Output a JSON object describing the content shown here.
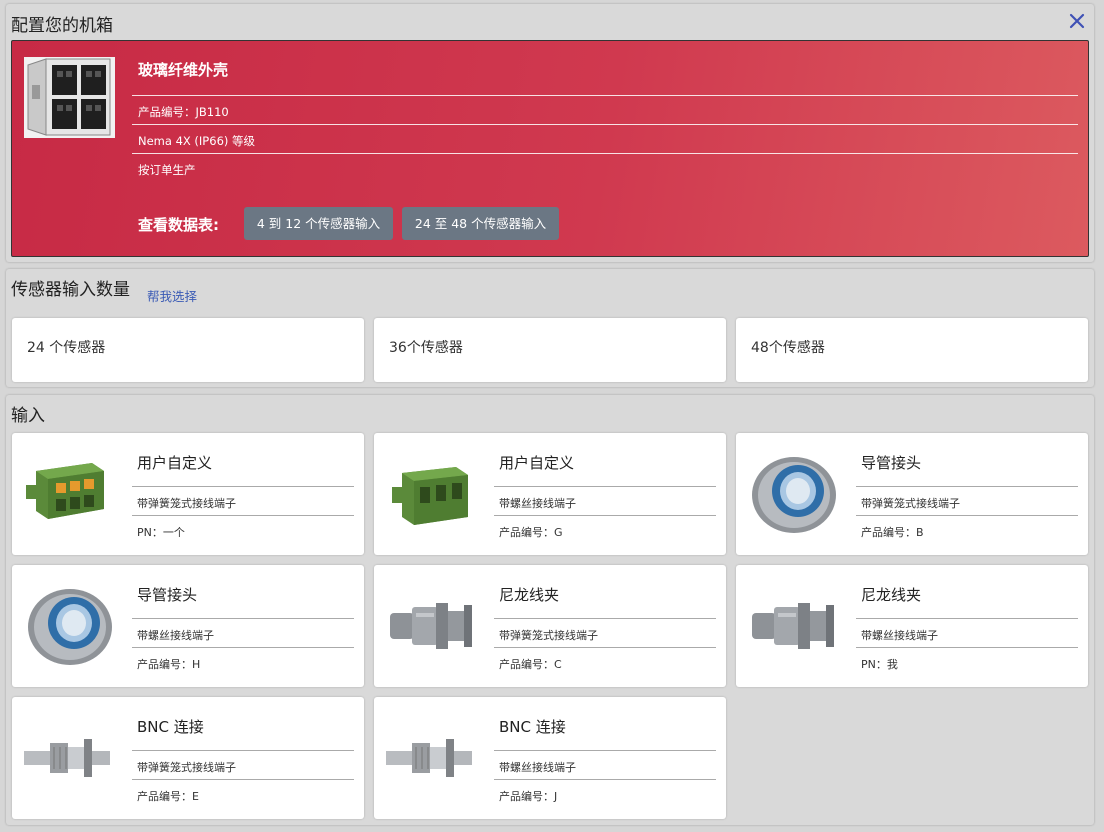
{
  "enclosure": {
    "section_title": "配置您的机箱",
    "close_icon": "close-icon",
    "product": {
      "name": "玻璃纤维外壳",
      "specs": [
        "产品编号：JB110",
        "Nema 4X (IP66) 等级",
        "按订单生产"
      ],
      "datasheet_label": "查看数据表:",
      "datasheet_buttons": [
        "4 到 12 个传感器输入",
        "24 至 48 个传感器输入"
      ]
    },
    "colors": {
      "accent_start": "#c72a45",
      "accent_end": "#dc5a5f",
      "button": "#6b7784"
    }
  },
  "sensors": {
    "section_title": "传感器输入数量",
    "help_link": "帮我选择",
    "options": [
      "24 个传感器",
      "36个传感器",
      "48个传感器"
    ]
  },
  "inputs": {
    "section_title": "输入",
    "items": [
      {
        "title": "用户自定义",
        "connector": "带弹簧笼式接线端子",
        "pn": "PN：一个",
        "icon": "spring-terminal-block-icon"
      },
      {
        "title": "用户自定义",
        "connector": "带螺丝接线端子",
        "pn": "产品编号：G",
        "icon": "screw-terminal-block-icon"
      },
      {
        "title": "导管接头",
        "connector": "带弹簧笼式接线端子",
        "pn": "产品编号：B",
        "icon": "conduit-fitting-icon"
      },
      {
        "title": "导管接头",
        "connector": "带螺丝接线端子",
        "pn": "产品编号：H",
        "icon": "conduit-fitting-icon"
      },
      {
        "title": "尼龙线夹",
        "connector": "带弹簧笼式接线端子",
        "pn": "产品编号：C",
        "icon": "cable-gland-icon"
      },
      {
        "title": "尼龙线夹",
        "connector": "带螺丝接线端子",
        "pn": "PN：我",
        "icon": "cable-gland-icon"
      },
      {
        "title": "BNC 连接",
        "connector": "带弹簧笼式接线端子",
        "pn": "产品编号：E",
        "icon": "bnc-connector-icon"
      },
      {
        "title": "BNC 连接",
        "connector": "带螺丝接线端子",
        "pn": "产品编号：J",
        "icon": "bnc-connector-icon"
      }
    ]
  }
}
